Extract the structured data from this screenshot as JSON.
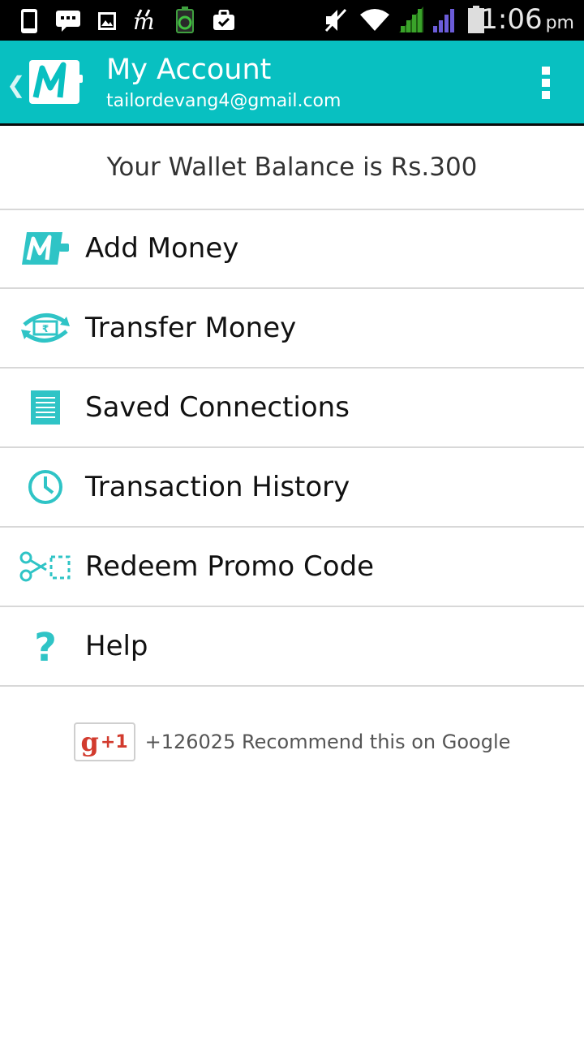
{
  "status_bar": {
    "time": "1:06",
    "ampm": "pm",
    "icons": [
      "phone-icon",
      "message-icon",
      "image-icon",
      "mobikwik-icon",
      "battery-saver-icon",
      "briefcase-icon",
      "mute-icon",
      "wifi-icon",
      "signal-1-icon",
      "signal-2-icon",
      "battery-icon"
    ]
  },
  "action_bar": {
    "title": "My Account",
    "subtitle": "tailordevang4@gmail.com",
    "color": "#08c0c1"
  },
  "wallet": {
    "text": "Your Wallet Balance is Rs.300"
  },
  "menu": {
    "items": [
      {
        "label": "Add Money",
        "icon": "mobikwik-logo-icon"
      },
      {
        "label": "Transfer Money",
        "icon": "transfer-icon"
      },
      {
        "label": "Saved Connections",
        "icon": "document-icon"
      },
      {
        "label": "Transaction History",
        "icon": "clock-icon"
      },
      {
        "label": "Redeem Promo Code",
        "icon": "scissors-icon"
      },
      {
        "label": "Help",
        "icon": "question-icon"
      }
    ],
    "icon_color": "#2fc4c6"
  },
  "gplus": {
    "button_g": "g",
    "button_plus": "+1",
    "text": "+126025 Recommend this on Google"
  }
}
